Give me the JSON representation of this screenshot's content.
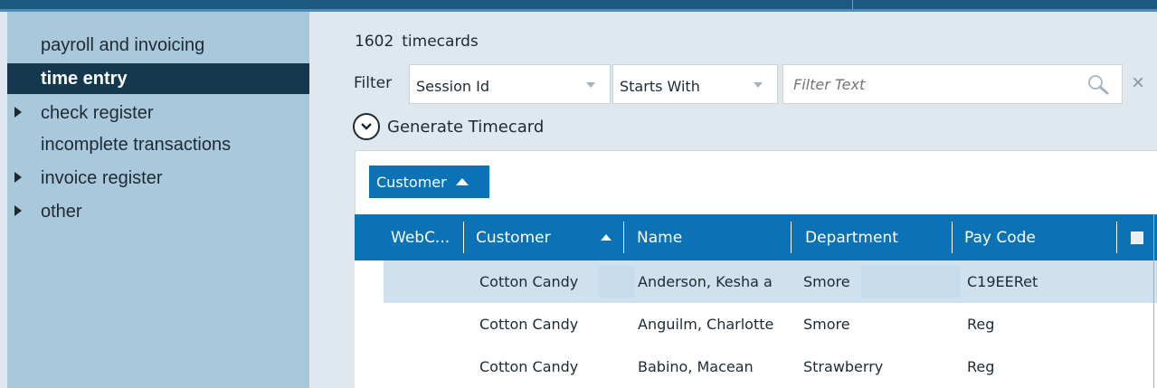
{
  "sidebar": {
    "items": [
      {
        "label": "payroll and invoicing",
        "expandable": false,
        "active": false
      },
      {
        "label": "time entry",
        "expandable": false,
        "active": true
      },
      {
        "label": "check register",
        "expandable": true,
        "active": false
      },
      {
        "label": "incomplete transactions",
        "expandable": false,
        "active": false
      },
      {
        "label": "invoice register",
        "expandable": true,
        "active": false
      },
      {
        "label": "other",
        "expandable": true,
        "active": false
      }
    ]
  },
  "summary": {
    "count": "1602",
    "label": "timecards"
  },
  "filter": {
    "label": "Filter",
    "field": "Session Id",
    "operator": "Starts With",
    "placeholder": "Filter Text"
  },
  "actions": {
    "generate_label": "Generate Timecard"
  },
  "grouping": {
    "chip_label": "Customer"
  },
  "table": {
    "columns": [
      "WebC...",
      "Customer",
      "Name",
      "Department",
      "Pay Code"
    ],
    "rows": [
      {
        "customer": "Cotton Candy",
        "name": "Anderson, Kesha a",
        "department": "Smore",
        "pay_code": "C19EERet",
        "selected": true
      },
      {
        "customer": "Cotton Candy",
        "name": "Anguilm, Charlotte",
        "department": "Smore",
        "pay_code": "Reg",
        "selected": false
      },
      {
        "customer": "Cotton Candy",
        "name": "Babino, Macean",
        "department": "Strawberry",
        "pay_code": "Reg",
        "selected": false
      }
    ]
  },
  "colors": {
    "header_bar": "#1d5a82",
    "sidebar_bg": "#a9c8dc",
    "active_nav": "#16384f",
    "accent": "#0b72b5",
    "selected_row": "#cfe1ee"
  }
}
